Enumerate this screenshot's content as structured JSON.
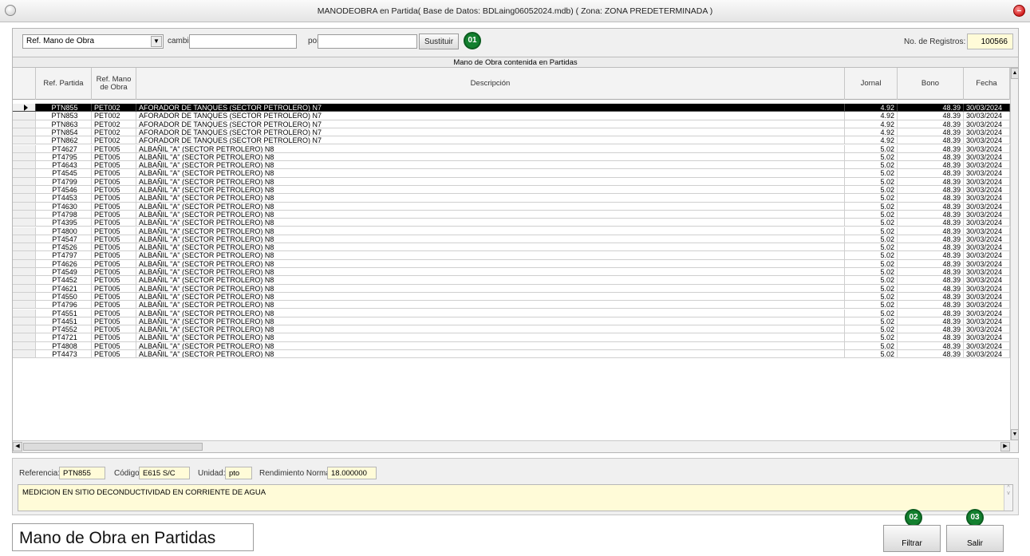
{
  "window": {
    "title": "MANODEOBRA en Partida( Base de Datos: BDLaing06052024.mdb) ( Zona: ZONA PREDETERMINADA )"
  },
  "toolbar": {
    "field_select": "Ref. Mano de Obra",
    "cambiar_label": "cambiar",
    "cambiar_value": "",
    "por_label": "por",
    "por_value": "",
    "sustituir_label": "Sustituir",
    "badge_sustituir": "01",
    "registros_label": "No. de Registros:",
    "registros_value": "100566"
  },
  "grid": {
    "caption": "Mano de Obra contenida en Partidas",
    "columns": [
      "Ref. Partida",
      "Ref. Mano de Obra",
      "Descripción",
      "Jornal",
      "Bono",
      "Fecha"
    ],
    "rows": [
      [
        "PTN855",
        "PET002",
        "AFORADOR DE TANQUES (SECTOR PETROLERO) N7",
        "4.92",
        "48.39",
        "30/03/2024"
      ],
      [
        "PTN853",
        "PET002",
        "AFORADOR DE TANQUES (SECTOR PETROLERO) N7",
        "4.92",
        "48.39",
        "30/03/2024"
      ],
      [
        "PTN863",
        "PET002",
        "AFORADOR DE TANQUES (SECTOR PETROLERO) N7",
        "4.92",
        "48.39",
        "30/03/2024"
      ],
      [
        "PTN854",
        "PET002",
        "AFORADOR DE TANQUES (SECTOR PETROLERO) N7",
        "4.92",
        "48.39",
        "30/03/2024"
      ],
      [
        "PTN862",
        "PET002",
        "AFORADOR DE TANQUES (SECTOR PETROLERO) N7",
        "4.92",
        "48.39",
        "30/03/2024"
      ],
      [
        "PT4627",
        "PET005",
        "ALBAÑIL \"A\" (SECTOR PETROLERO) N8",
        "5.02",
        "48.39",
        "30/03/2024"
      ],
      [
        "PT4795",
        "PET005",
        "ALBAÑIL \"A\" (SECTOR PETROLERO) N8",
        "5.02",
        "48.39",
        "30/03/2024"
      ],
      [
        "PT4643",
        "PET005",
        "ALBAÑIL \"A\" (SECTOR PETROLERO) N8",
        "5.02",
        "48.39",
        "30/03/2024"
      ],
      [
        "PT4545",
        "PET005",
        "ALBAÑIL \"A\" (SECTOR PETROLERO) N8",
        "5.02",
        "48.39",
        "30/03/2024"
      ],
      [
        "PT4799",
        "PET005",
        "ALBAÑIL \"A\" (SECTOR PETROLERO) N8",
        "5.02",
        "48.39",
        "30/03/2024"
      ],
      [
        "PT4546",
        "PET005",
        "ALBAÑIL \"A\" (SECTOR PETROLERO) N8",
        "5.02",
        "48.39",
        "30/03/2024"
      ],
      [
        "PT4453",
        "PET005",
        "ALBAÑIL \"A\" (SECTOR PETROLERO) N8",
        "5.02",
        "48.39",
        "30/03/2024"
      ],
      [
        "PT4630",
        "PET005",
        "ALBAÑIL \"A\" (SECTOR PETROLERO) N8",
        "5.02",
        "48.39",
        "30/03/2024"
      ],
      [
        "PT4798",
        "PET005",
        "ALBAÑIL \"A\" (SECTOR PETROLERO) N8",
        "5.02",
        "48.39",
        "30/03/2024"
      ],
      [
        "PT4395",
        "PET005",
        "ALBAÑIL \"A\" (SECTOR PETROLERO) N8",
        "5.02",
        "48.39",
        "30/03/2024"
      ],
      [
        "PT4800",
        "PET005",
        "ALBAÑIL \"A\" (SECTOR PETROLERO) N8",
        "5.02",
        "48.39",
        "30/03/2024"
      ],
      [
        "PT4547",
        "PET005",
        "ALBAÑIL \"A\" (SECTOR PETROLERO) N8",
        "5.02",
        "48.39",
        "30/03/2024"
      ],
      [
        "PT4526",
        "PET005",
        "ALBAÑIL \"A\" (SECTOR PETROLERO) N8",
        "5.02",
        "48.39",
        "30/03/2024"
      ],
      [
        "PT4797",
        "PET005",
        "ALBAÑIL \"A\" (SECTOR PETROLERO) N8",
        "5.02",
        "48.39",
        "30/03/2024"
      ],
      [
        "PT4626",
        "PET005",
        "ALBAÑIL \"A\" (SECTOR PETROLERO) N8",
        "5.02",
        "48.39",
        "30/03/2024"
      ],
      [
        "PT4549",
        "PET005",
        "ALBAÑIL \"A\" (SECTOR PETROLERO) N8",
        "5.02",
        "48.39",
        "30/03/2024"
      ],
      [
        "PT4452",
        "PET005",
        "ALBAÑIL \"A\" (SECTOR PETROLERO) N8",
        "5.02",
        "48.39",
        "30/03/2024"
      ],
      [
        "PT4621",
        "PET005",
        "ALBAÑIL \"A\" (SECTOR PETROLERO) N8",
        "5.02",
        "48.39",
        "30/03/2024"
      ],
      [
        "PT4550",
        "PET005",
        "ALBAÑIL \"A\" (SECTOR PETROLERO) N8",
        "5.02",
        "48.39",
        "30/03/2024"
      ],
      [
        "PT4796",
        "PET005",
        "ALBAÑIL \"A\" (SECTOR PETROLERO) N8",
        "5.02",
        "48.39",
        "30/03/2024"
      ],
      [
        "PT4551",
        "PET005",
        "ALBAÑIL \"A\" (SECTOR PETROLERO) N8",
        "5.02",
        "48.39",
        "30/03/2024"
      ],
      [
        "PT4451",
        "PET005",
        "ALBAÑIL \"A\" (SECTOR PETROLERO) N8",
        "5.02",
        "48.39",
        "30/03/2024"
      ],
      [
        "PT4552",
        "PET005",
        "ALBAÑIL \"A\" (SECTOR PETROLERO) N8",
        "5.02",
        "48.39",
        "30/03/2024"
      ],
      [
        "PT4721",
        "PET005",
        "ALBAÑIL \"A\" (SECTOR PETROLERO) N8",
        "5.02",
        "48.39",
        "30/03/2024"
      ],
      [
        "PT4808",
        "PET005",
        "ALBAÑIL \"A\" (SECTOR PETROLERO) N8",
        "5.02",
        "48.39",
        "30/03/2024"
      ],
      [
        "PT4473",
        "PET005",
        "ALBAÑIL \"A\" (SECTOR PETROLERO) N8",
        "5.02",
        "48.39",
        "30/03/2024"
      ]
    ],
    "selected_row": 0
  },
  "detail": {
    "referencia_label": "Referencia:",
    "referencia_value": "PTN855",
    "codigo_label": "Código:",
    "codigo_value": "E615 S/C",
    "unidad_label": "Unidad:",
    "unidad_value": "pto",
    "rendimiento_label": "Rendimiento Normal:",
    "rendimiento_value": "18.000000",
    "descripcion": "MEDICION  EN SITIO DECONDUCTIVIDAD EN CORRIENTE DE AGUA"
  },
  "footer": {
    "title": "Mano de Obra en Partidas",
    "filtrar_label": "Filtrar",
    "salir_label": "Salir",
    "badge_filtrar": "02",
    "badge_salir": "03"
  },
  "colors": {
    "badge": "#13802f",
    "yellow_field": "#fffbd8",
    "selected_row": "#000000"
  }
}
